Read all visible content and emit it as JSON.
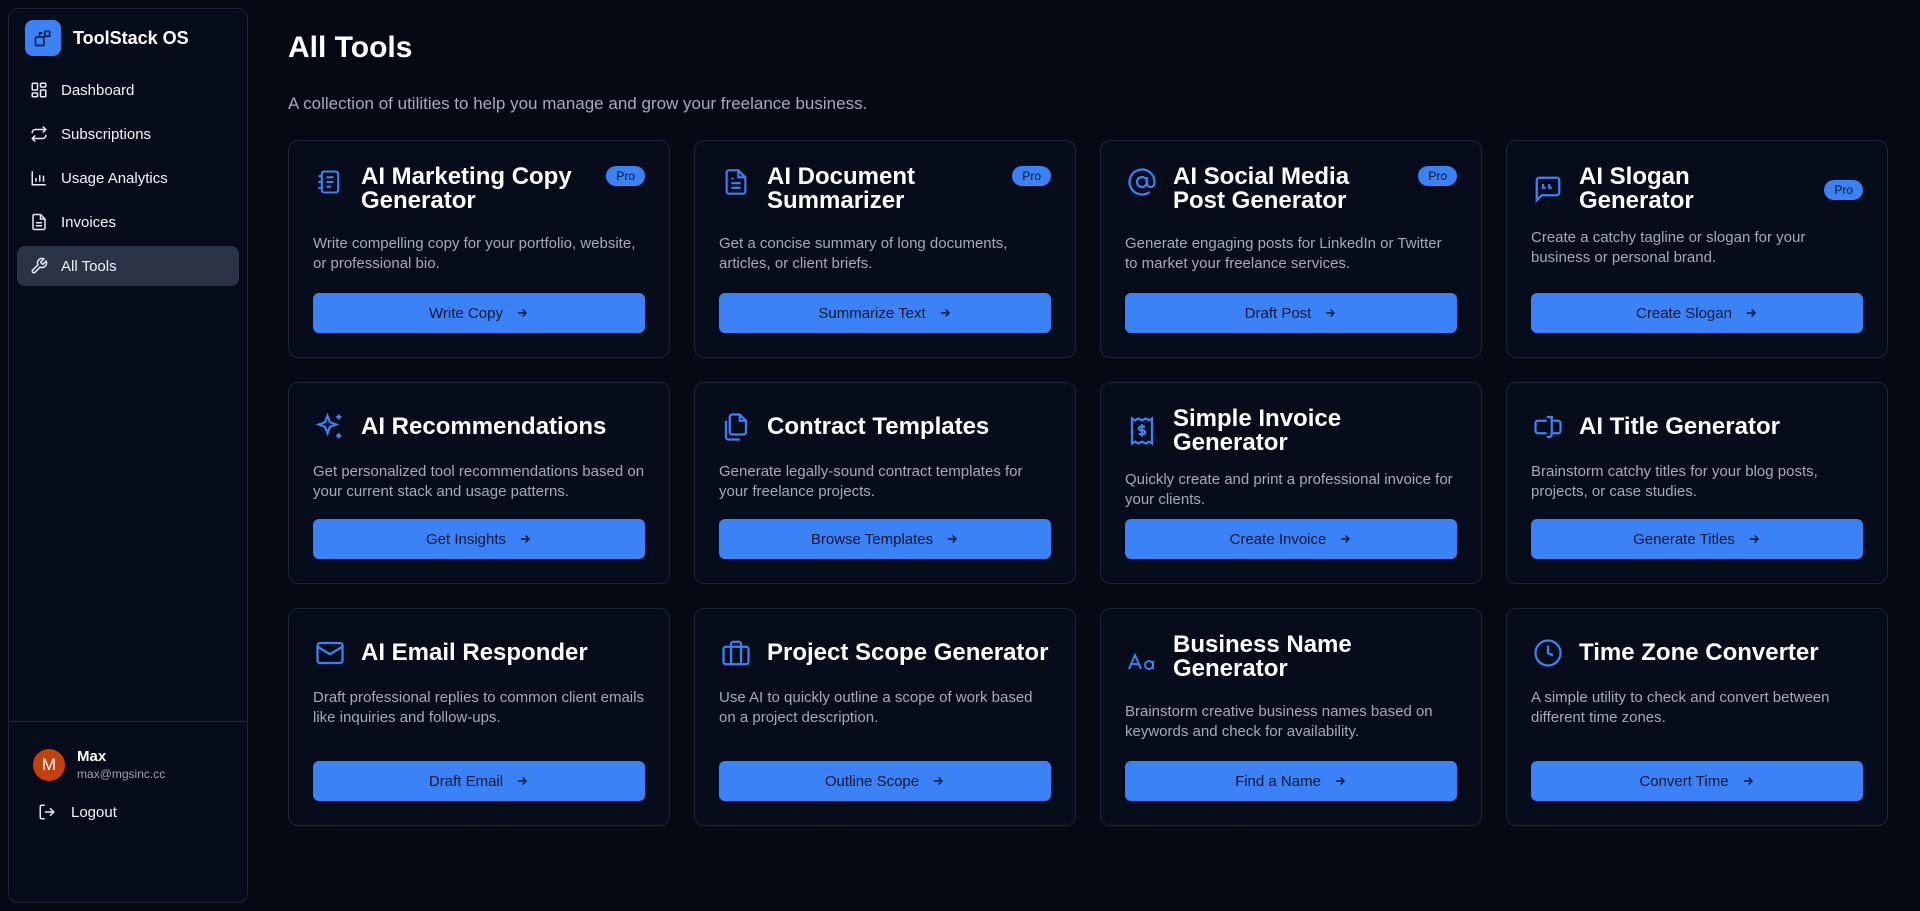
{
  "app": {
    "name": "ToolStack OS"
  },
  "sidebar": {
    "items": [
      {
        "label": "Dashboard",
        "icon": "dashboard-icon"
      },
      {
        "label": "Subscriptions",
        "icon": "refresh-icon"
      },
      {
        "label": "Usage Analytics",
        "icon": "bar-chart-icon"
      },
      {
        "label": "Invoices",
        "icon": "document-icon"
      },
      {
        "label": "All Tools",
        "icon": "wrench-icon",
        "active": true
      }
    ]
  },
  "user": {
    "initial": "M",
    "name": "Max",
    "email": "max@mgsinc.cc",
    "logout_label": "Logout"
  },
  "page": {
    "title": "All Tools",
    "subtitle": "A collection of utilities to help you manage and grow your freelance business."
  },
  "colors": {
    "accent": "#3b82f6",
    "background": "#040914",
    "card": "#060c1a",
    "avatar": "#c2410c"
  },
  "tools": [
    {
      "title": "AI Marketing Copy Generator",
      "pro": "Pro",
      "icon": "notebook-icon",
      "desc": "Write compelling copy for your portfolio, website, or professional bio.",
      "button": "Write Copy"
    },
    {
      "title": "AI Document Summarizer",
      "pro": "Pro",
      "icon": "document-icon",
      "desc": "Get a concise summary of long documents, articles, or client briefs.",
      "button": "Summarize Text"
    },
    {
      "title": "AI Social Media Post Generator",
      "pro": "Pro",
      "icon": "at-sign-icon",
      "desc": "Generate engaging posts for LinkedIn or Twitter to market your freelance services.",
      "button": "Draft Post"
    },
    {
      "title": "AI Slogan Generator",
      "pro": "Pro",
      "icon": "quote-bubble-icon",
      "desc": "Create a catchy tagline or slogan for your business or personal brand.",
      "button": "Create Slogan"
    },
    {
      "title": "AI Recommendations",
      "pro": "",
      "icon": "sparkles-icon",
      "desc": "Get personalized tool recommendations based on your current stack and usage patterns.",
      "button": "Get Insights"
    },
    {
      "title": "Contract Templates",
      "pro": "",
      "icon": "copy-icon",
      "desc": "Generate legally-sound contract templates for your freelance projects.",
      "button": "Browse Templates"
    },
    {
      "title": "Simple Invoice Generator",
      "pro": "",
      "icon": "receipt-icon",
      "desc": "Quickly create and print a professional invoice for your clients.",
      "button": "Create Invoice"
    },
    {
      "title": "AI Title Generator",
      "pro": "",
      "icon": "text-cursor-icon",
      "desc": "Brainstorm catchy titles for your blog posts, projects, or case studies.",
      "button": "Generate Titles"
    },
    {
      "title": "AI Email Responder",
      "pro": "",
      "icon": "mail-icon",
      "desc": "Draft professional replies to common client emails like inquiries and follow-ups.",
      "button": "Draft Email"
    },
    {
      "title": "Project Scope Generator",
      "pro": "",
      "icon": "briefcase-icon",
      "desc": "Use AI to quickly outline a scope of work based on a project description.",
      "button": "Outline Scope"
    },
    {
      "title": "Business Name Generator",
      "pro": "",
      "icon": "font-icon",
      "desc": "Brainstorm creative business names based on keywords and check for availability.",
      "button": "Find a Name"
    },
    {
      "title": "Time Zone Converter",
      "pro": "",
      "icon": "clock-icon",
      "desc": "A simple utility to check and convert between different time zones.",
      "button": "Convert Time"
    }
  ]
}
